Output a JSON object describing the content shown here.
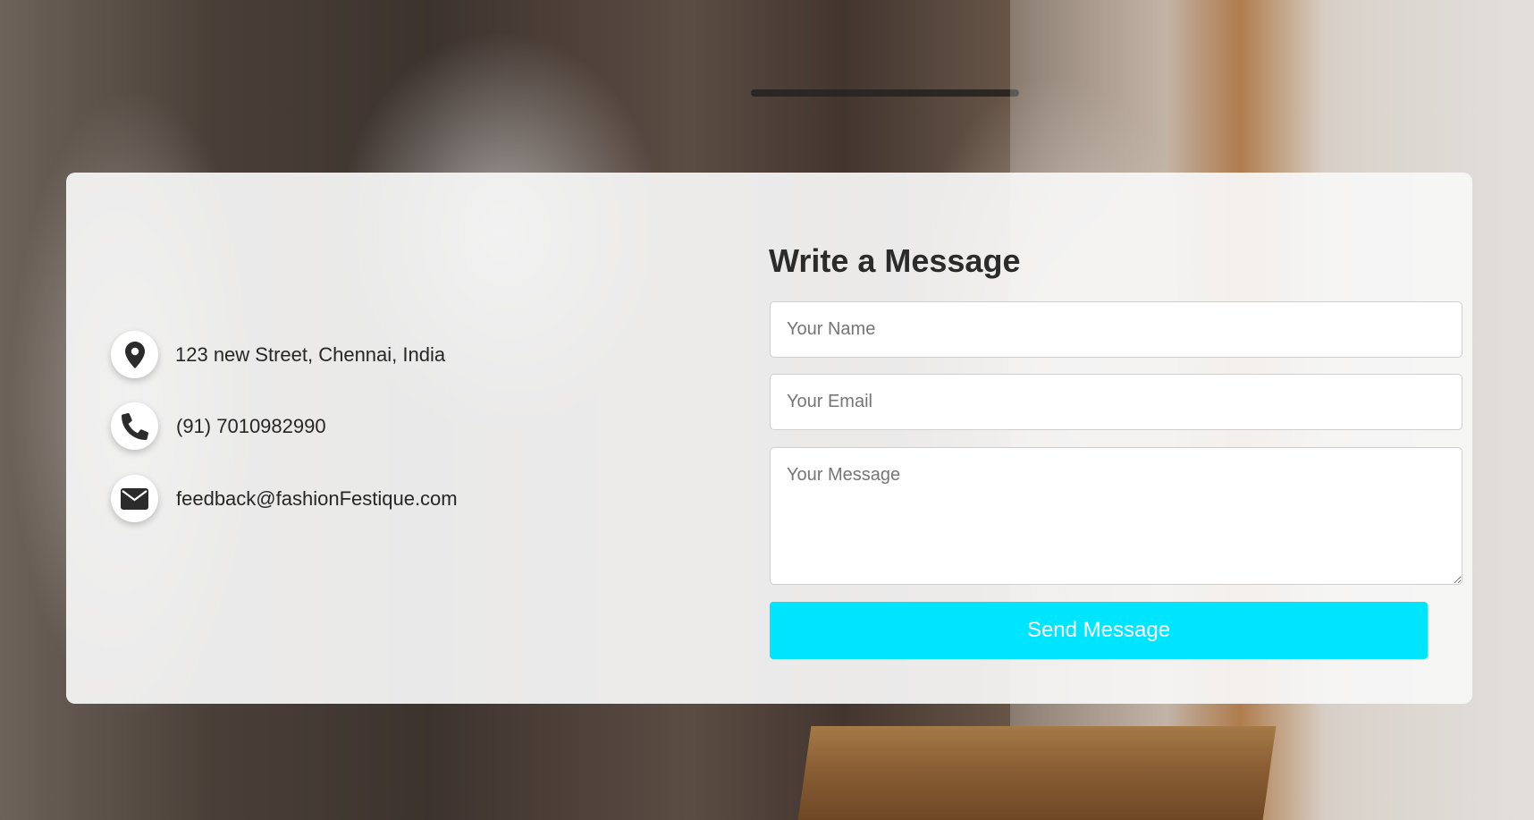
{
  "contact": {
    "address": "123 new Street, Chennai, India",
    "phone": "(91) 7010982990",
    "email": "feedback@fashionFestique.com"
  },
  "form": {
    "title": "Write a Message",
    "name_placeholder": "Your Name",
    "email_placeholder": "Your Email",
    "message_placeholder": "Your Message",
    "send_label": "Send Message"
  },
  "colors": {
    "button": "#00e5ff",
    "text": "#262626",
    "card": "#f8f8f8"
  },
  "icons": {
    "address": "map-pin-icon",
    "phone": "phone-icon",
    "email": "envelope-icon"
  }
}
